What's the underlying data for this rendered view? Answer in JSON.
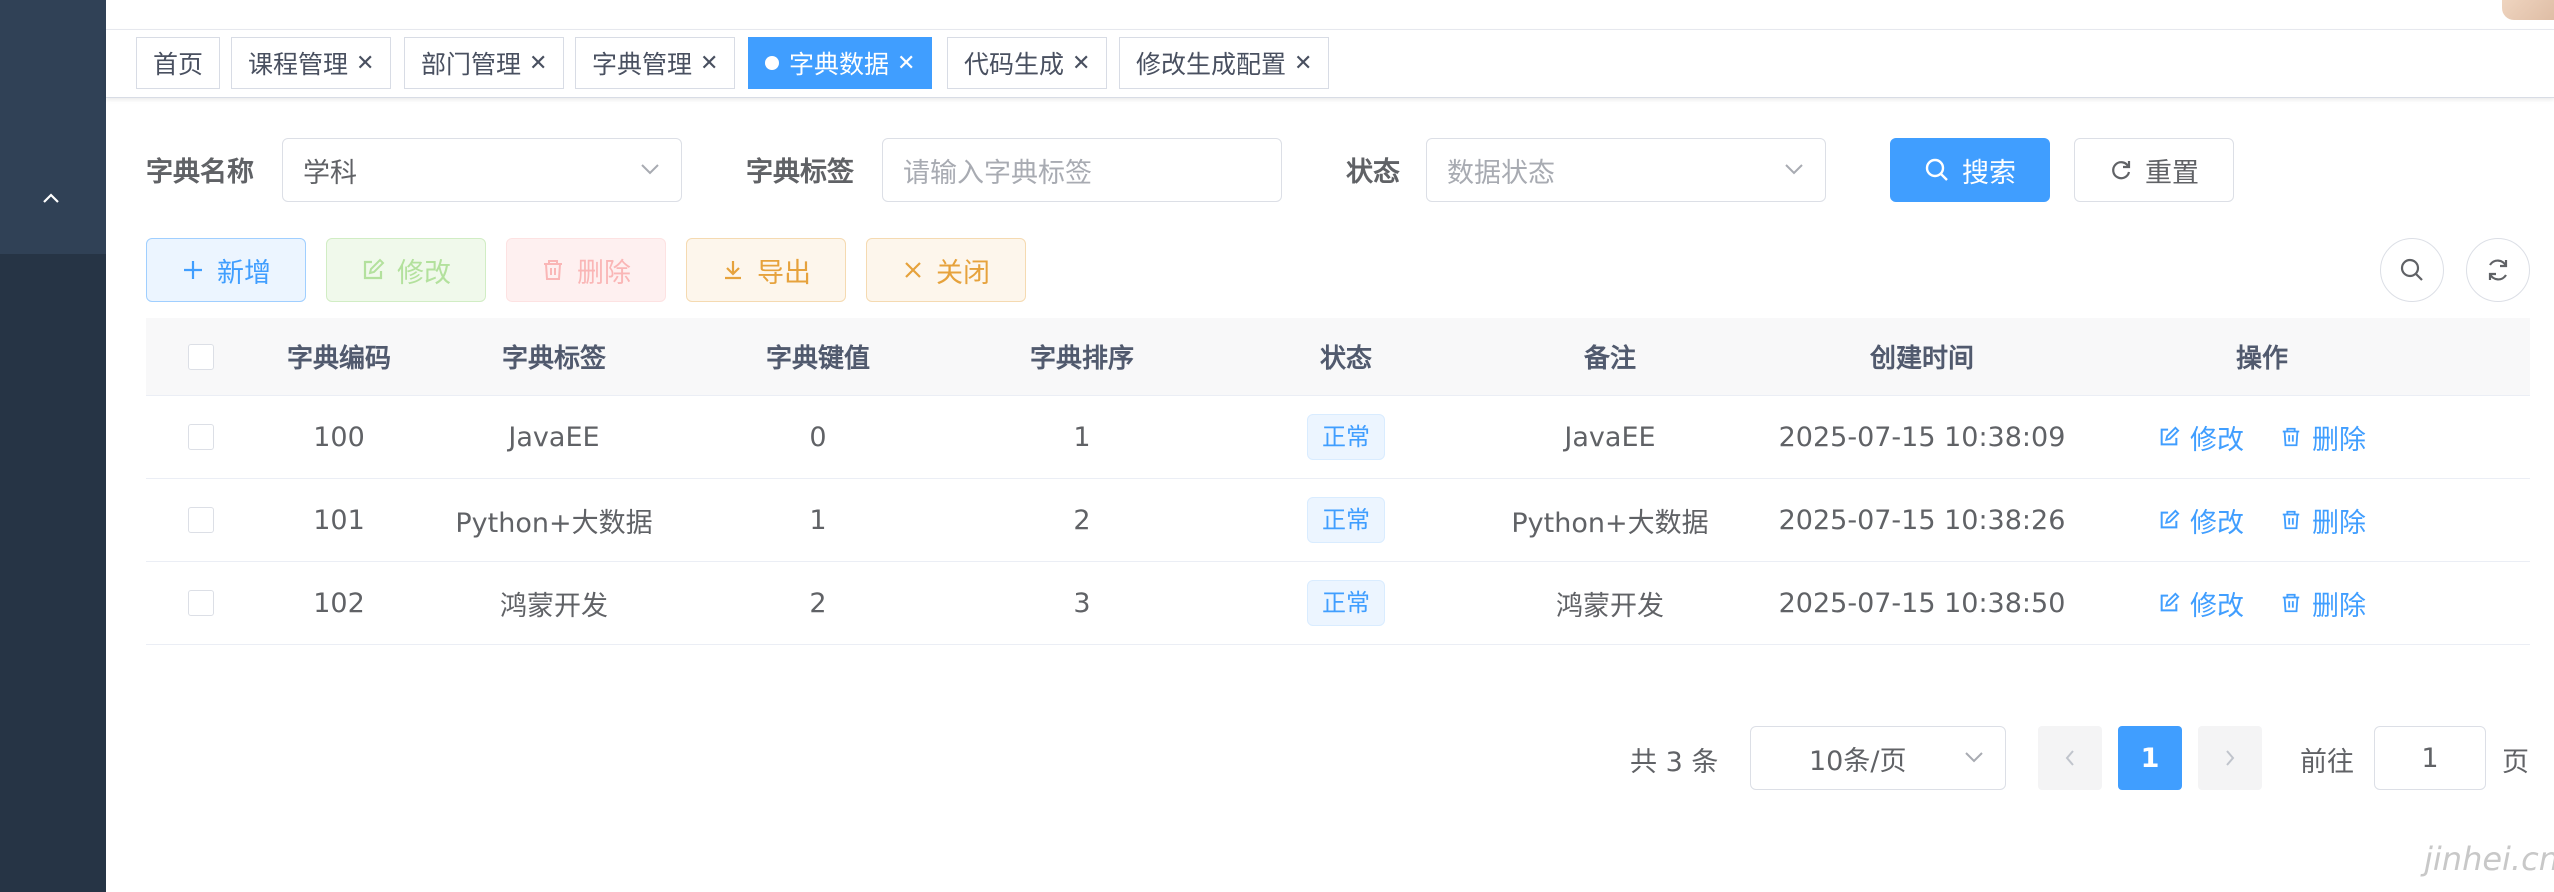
{
  "tabs": [
    {
      "label": "首页",
      "closable": false,
      "active": false
    },
    {
      "label": "课程管理",
      "closable": true,
      "active": false
    },
    {
      "label": "部门管理",
      "closable": true,
      "active": false
    },
    {
      "label": "字典管理",
      "closable": true,
      "active": false
    },
    {
      "label": "字典数据",
      "closable": true,
      "active": true
    },
    {
      "label": "代码生成",
      "closable": true,
      "active": false
    },
    {
      "label": "修改生成配置",
      "closable": true,
      "active": false
    }
  ],
  "form": {
    "dict_name_label": "字典名称",
    "dict_name_value": "学科",
    "dict_label_label": "字典标签",
    "dict_label_placeholder": "请输入字典标签",
    "status_label": "状态",
    "status_placeholder": "数据状态",
    "search_button": "搜索",
    "reset_button": "重置"
  },
  "toolbar": {
    "add": "新增",
    "edit": "修改",
    "delete": "删除",
    "export": "导出",
    "close": "关闭"
  },
  "table": {
    "columns": [
      "字典编码",
      "字典标签",
      "字典键值",
      "字典排序",
      "状态",
      "备注",
      "创建时间",
      "操作"
    ],
    "rows": [
      {
        "code": "100",
        "label": "JavaEE",
        "value": "0",
        "sort": "1",
        "status": "正常",
        "remark": "JavaEE",
        "created": "2025-07-15 10:38:09"
      },
      {
        "code": "101",
        "label": "Python+大数据",
        "value": "1",
        "sort": "2",
        "status": "正常",
        "remark": "Python+大数据",
        "created": "2025-07-15 10:38:26"
      },
      {
        "code": "102",
        "label": "鸿蒙开发",
        "value": "2",
        "sort": "3",
        "status": "正常",
        "remark": "鸿蒙开发",
        "created": "2025-07-15 10:38:50"
      }
    ],
    "op_edit": "修改",
    "op_delete": "删除"
  },
  "pagination": {
    "total": "共 3 条",
    "page_size": "10条/页",
    "current_page": "1",
    "goto_label": "前往",
    "goto_value": "1",
    "unit": "页"
  },
  "watermark": "jinhei.cn",
  "colors": {
    "primary": "#409eff",
    "sidebar": "#304156",
    "success": "#67c23a",
    "danger": "#f56c6c",
    "warning": "#e6a23c"
  }
}
